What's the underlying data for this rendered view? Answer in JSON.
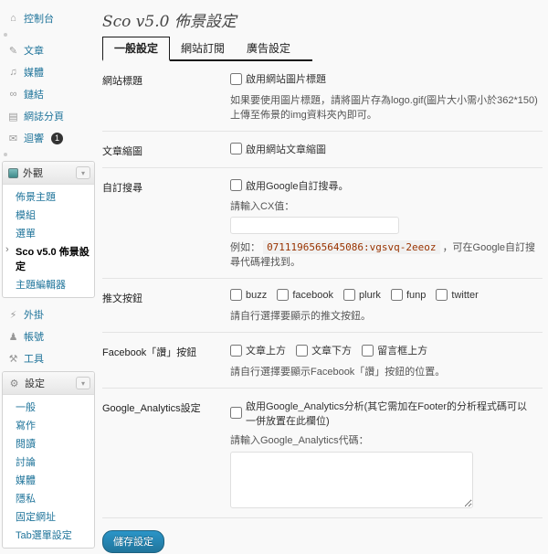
{
  "colors": {
    "wp_link_blue": "#21759b",
    "tab_border": "#1a1a1a",
    "badge_bg": "#333333",
    "code_text": "#993300",
    "button_bg": "#21759b",
    "page_bg": "#f9f9f9"
  },
  "sidebar": {
    "dashboard": {
      "icon": "home-icon",
      "glyph": "⌂",
      "label": "控制台"
    },
    "posts": {
      "icon": "posts-icon",
      "glyph": "✎",
      "label": "文章"
    },
    "media": {
      "icon": "media-icon",
      "glyph": "♫",
      "label": "媒體"
    },
    "links": {
      "icon": "links-icon",
      "glyph": "∞",
      "label": "鏈結"
    },
    "pages": {
      "icon": "pages-icon",
      "glyph": "▤",
      "label": "網誌分頁"
    },
    "comments": {
      "icon": "comments-icon",
      "glyph": "✉",
      "label": "迴響",
      "badge": "1"
    },
    "appearance": {
      "icon": "appearance-icon",
      "label": "外觀",
      "toggle_glyph": "▾",
      "submenu": [
        "佈景主題",
        "模組",
        "選單",
        "Sco v5.0 佈景設定",
        "主題編輯器"
      ],
      "current": "Sco v5.0 佈景設定"
    },
    "plugins": {
      "icon": "plugins-icon",
      "glyph": "⚡",
      "label": "外掛"
    },
    "users": {
      "icon": "users-icon",
      "glyph": "♟",
      "label": "帳號"
    },
    "tools": {
      "icon": "tools-icon",
      "glyph": "⚒",
      "label": "工具"
    },
    "settings": {
      "icon": "settings-icon",
      "glyph": "⚙",
      "label": "設定",
      "toggle_glyph": "▾",
      "submenu": [
        "一般",
        "寫作",
        "閱讀",
        "討論",
        "媒體",
        "隱私",
        "固定網址",
        "Tab選單設定"
      ]
    }
  },
  "main": {
    "title": "Sco v5.0 佈景設定",
    "tabs": [
      "一般設定",
      "網站訂閱",
      "廣告設定"
    ],
    "rows": {
      "site_title": {
        "label": "網站標題",
        "checkbox": "啟用網站圖片標題",
        "desc": "如果要使用圖片標題，請將圖片存為logo.gif(圖片大小需小於362*150)上傳至佈景的img資料夾內即可。"
      },
      "thumbnail": {
        "label": "文章縮圖",
        "checkbox": "啟用網站文章縮圖"
      },
      "custom_search": {
        "label": "自訂搜尋",
        "checkbox": "啟用Google自訂搜尋。",
        "input_label": "請輸入CX值：",
        "input_value": "",
        "example_prefix": "例如：",
        "example_code": "0711196565645086:vgsvq-2eeoz",
        "example_suffix": "，可在Google自訂搜尋代碼裡找到。"
      },
      "tweet_buttons": {
        "label": "推文按鈕",
        "options": [
          "buzz",
          "facebook",
          "plurk",
          "funp",
          "twitter"
        ],
        "desc": "請自行選擇要顯示的推文按鈕。"
      },
      "fb_like": {
        "label": "Facebook「讚」按鈕",
        "options": [
          "文章上方",
          "文章下方",
          "留言框上方"
        ],
        "desc": "請自行選擇要顯示Facebook「讚」按鈕的位置。"
      },
      "analytics": {
        "label": "Google_Analytics設定",
        "checkbox": "啟用Google_Analytics分析(其它需加在Footer的分析程式碼可以一併放置在此欄位)",
        "input_label": "請輸入Google_Analytics代碼：",
        "textarea_value": ""
      }
    },
    "save_button": "儲存設定"
  }
}
